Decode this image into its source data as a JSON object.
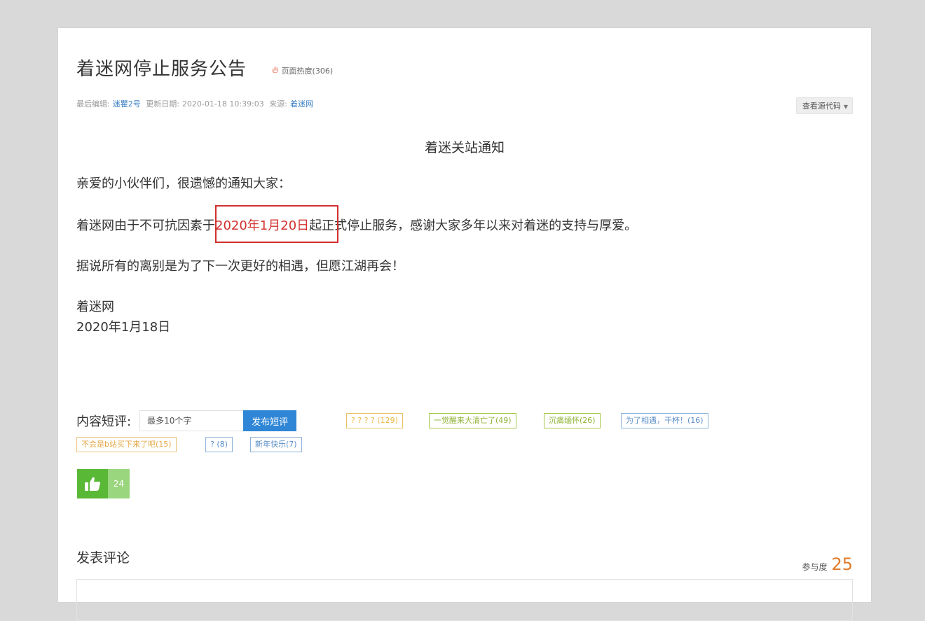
{
  "article": {
    "title": "着迷网停止服务公告",
    "heat": "页面热度(306)",
    "meta": {
      "editor_label": "最后编辑:",
      "editor": "迷瞿2号",
      "date_label": "更新日期:",
      "date": "2020-01-18 10:39:03",
      "source_label": "来源:",
      "source": "着迷网"
    },
    "view_source_label": "查看源代码"
  },
  "notice": {
    "title": "着迷关站通知",
    "greeting": "亲爱的小伙伴们，很遗憾的通知大家：",
    "body_pre": "着迷网由于不可抗因素于",
    "body_date": "2020年1月20日",
    "body_post": "起正式停止服务，感谢大家多年以来对着迷的支持与厚爱。",
    "farewell": "据说所有的离别是为了下一次更好的相遇，但愿江湖再会！",
    "signature": "着迷网",
    "signature_date": "2020年1月18日"
  },
  "short_comment": {
    "label": "内容短评:",
    "placeholder": "最多10个字",
    "publish_label": "发布短评",
    "tags": [
      {
        "text": "? ? ? ? (129)",
        "color": "#e9b745"
      },
      {
        "text": "一觉醒来大清亡了(49)",
        "color": "#8fb234"
      },
      {
        "text": "沉痛缅怀(26)",
        "color": "#8fb234"
      },
      {
        "text": "为了相遇，干杯！(16)",
        "color": "#5a8dc6"
      },
      {
        "text": "不会是b站买下来了吧(15)",
        "color": "#e4a847"
      },
      {
        "text": "? (8)",
        "color": "#5a8dc6"
      },
      {
        "text": "新年快乐(7)",
        "color": "#5a8dc6"
      }
    ]
  },
  "like": {
    "icon": "thumbs-up-icon",
    "count": "24"
  },
  "comments": {
    "title": "发表评论",
    "participation_label": "参与度",
    "participation_value": "25"
  }
}
